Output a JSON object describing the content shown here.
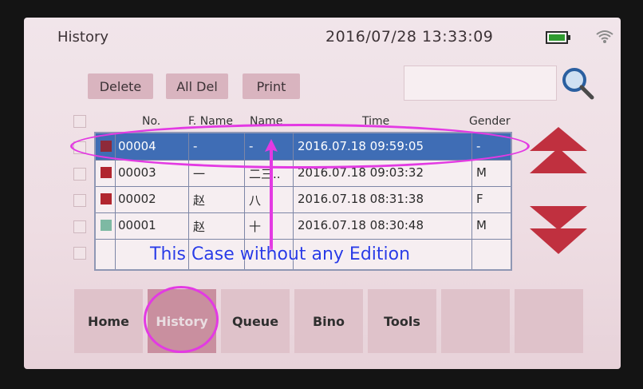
{
  "header": {
    "title": "History",
    "datetime": "2016/07/28 13:33:09"
  },
  "toolbar": {
    "delete_label": "Delete",
    "all_del_label": "All Del",
    "print_label": "Print",
    "search_value": ""
  },
  "table": {
    "columns": [
      "No.",
      "F. Name",
      "Name",
      "Time",
      "Gender"
    ],
    "rows": [
      {
        "no": "00004",
        "fname": "-",
        "name": "-",
        "time": "2016.07.18 09:59:05",
        "gender": "-",
        "color": "#8e2a3a"
      },
      {
        "no": "00003",
        "fname": "一",
        "name": "二三..",
        "time": "2016.07.18 09:03:32",
        "gender": "M",
        "color": "#b1262f"
      },
      {
        "no": "00002",
        "fname": "赵",
        "name": "八",
        "time": "2016.07.18 08:31:38",
        "gender": "F",
        "color": "#b1262f"
      },
      {
        "no": "00001",
        "fname": "赵",
        "name": "十",
        "time": "2016.07.18 08:30:48",
        "gender": "M",
        "color": "#7db9a3"
      }
    ]
  },
  "nav": {
    "items": [
      {
        "label": "Home"
      },
      {
        "label": "History"
      },
      {
        "label": "Queue"
      },
      {
        "label": "Bino"
      },
      {
        "label": "Tools"
      },
      {
        "label": ""
      },
      {
        "label": ""
      }
    ]
  },
  "annotation": {
    "text": "This Case without any Edition",
    "color": "#e33ae3"
  },
  "colors": {
    "accent": "#d9b4bf",
    "selected_row": "#3f6db5",
    "arrow": "#c0303f"
  }
}
